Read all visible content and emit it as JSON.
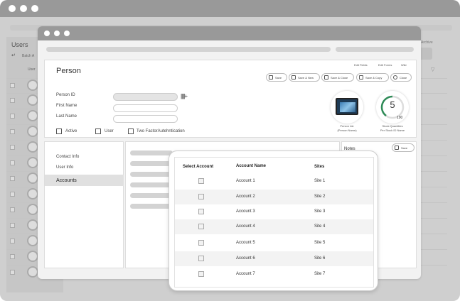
{
  "background": {
    "title": "Users",
    "subheading": "Batch A",
    "column": "User",
    "archive": "Archive"
  },
  "toolbar": {
    "links": [
      "Edit Fields",
      "Edit Forms",
      "Wiki"
    ],
    "buttons": [
      "Save",
      "Save & New",
      "Save & Close",
      "Save & Copy",
      "Close"
    ]
  },
  "person": {
    "title": "Person",
    "fields": [
      "Person ID",
      "First Name",
      "Last Name"
    ],
    "checkboxes": [
      "Active",
      "User",
      "Two FactorAutehntication"
    ],
    "image_caption": [
      "Person Ide",
      "(Person Name)"
    ],
    "stock": {
      "value": "5",
      "sub": "190",
      "caption": [
        "Stock Quantities",
        "Per Stock ID Name"
      ]
    }
  },
  "sidebar": {
    "items": [
      "Contact Info",
      "User Info",
      "Accounts"
    ],
    "active": "Accounts"
  },
  "notes": {
    "label": "Notes",
    "save": "Save"
  },
  "accounts_table": {
    "headers": [
      "Select Account",
      "Account Name",
      "Sites"
    ],
    "rows": [
      {
        "name": "Account 1",
        "site": "Site 1"
      },
      {
        "name": "Account 2",
        "site": "Site 2"
      },
      {
        "name": "Account 3",
        "site": "Site 3"
      },
      {
        "name": "Account 4",
        "site": "Site 4"
      },
      {
        "name": "Account 5",
        "site": "Site 5"
      },
      {
        "name": "Account 6",
        "site": "Site 6"
      },
      {
        "name": "Account 7",
        "site": "Site 7"
      }
    ]
  },
  "colors": {
    "frame": "#999999",
    "backdrop": "#cfcfcf",
    "stock_ring": "#2e8b57"
  }
}
